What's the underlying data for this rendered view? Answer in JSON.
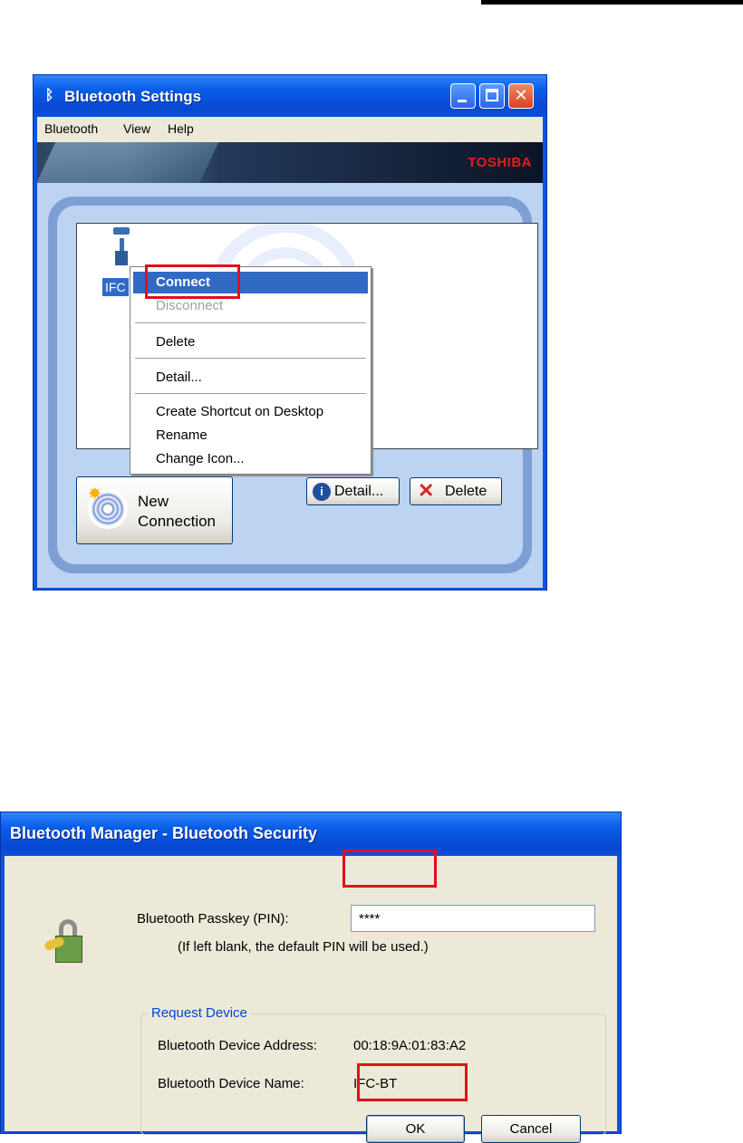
{
  "window1": {
    "title": "Bluetooth Settings",
    "menu": [
      "Bluetooth",
      "View",
      "Help"
    ],
    "brand": "TOSHIBA",
    "device_label": "IFC",
    "context_menu": {
      "connect": "Connect",
      "disconnect": "Disconnect",
      "delete": "Delete",
      "detail": "Detail...",
      "create_shortcut": "Create Shortcut on Desktop",
      "rename": "Rename",
      "change_icon": "Change Icon..."
    },
    "buttons": {
      "new_connection_line1": "New",
      "new_connection_line2": "Connection",
      "detail": "Detail...",
      "delete": "Delete"
    }
  },
  "dialog": {
    "title": "Bluetooth Manager - Bluetooth Security",
    "pin_label": "Bluetooth Passkey (PIN):",
    "pin_value": "****",
    "pin_hint": "(If left blank, the default PIN will be used.)",
    "group_title": "Request Device",
    "address_label": "Bluetooth Device Address:",
    "address_value": "00:18:9A:01:83:A2",
    "name_label": "Bluetooth Device Name:",
    "name_value": "IFC-BT",
    "ok_label": "OK",
    "cancel_label": "Cancel"
  },
  "colors": {
    "title_bar": "#0a55e0",
    "highlight": "#316ac5",
    "annotation_box": "#e0101a",
    "brand": "#e31c1c"
  }
}
